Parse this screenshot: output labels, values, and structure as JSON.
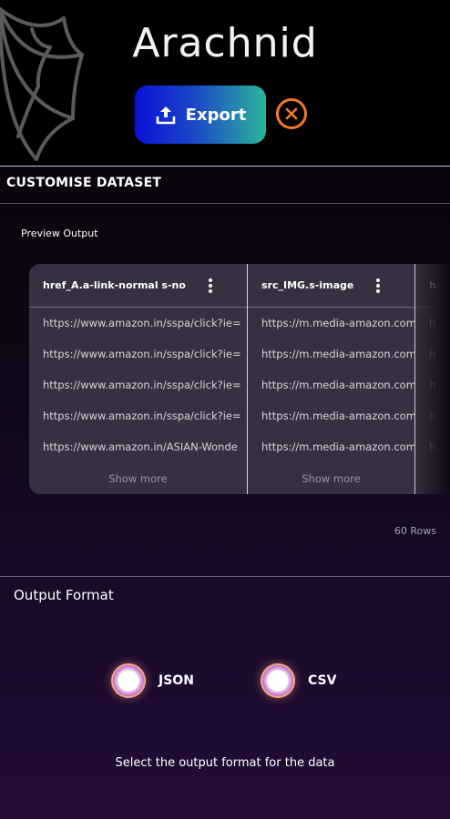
{
  "header": {
    "app_title": "Arachnid",
    "export_label": "Export"
  },
  "section": {
    "title": "CUSTOMISE DATASET",
    "preview_label": "Preview Output"
  },
  "table": {
    "columns": [
      {
        "header": "href_A.a-link-normal s-no",
        "cells": [
          "https://www.amazon.in/sspa/click?ie=",
          "https://www.amazon.in/sspa/click?ie=",
          "https://www.amazon.in/sspa/click?ie=",
          "https://www.amazon.in/sspa/click?ie=",
          "https://www.amazon.in/ASIAN-Wonde"
        ],
        "show_more": "Show more"
      },
      {
        "header": "src_IMG.s-image",
        "cells": [
          "https://m.media-amazon.com",
          "https://m.media-amazon.com",
          "https://m.media-amazon.com",
          "https://m.media-amazon.com",
          "https://m.media-amazon.com"
        ],
        "show_more": "Show more"
      },
      {
        "header": "h",
        "cells": [
          "h",
          "h",
          "h",
          "h",
          "h"
        ],
        "show_more": ""
      }
    ],
    "rows_count": "60 Rows"
  },
  "output": {
    "title": "Output Format",
    "options": [
      {
        "label": "JSON"
      },
      {
        "label": "CSV"
      }
    ],
    "hint": "Select the output format for the data"
  },
  "colors": {
    "export_gradient_start": "#0a12d8",
    "export_gradient_end": "#2bb59a",
    "close_accent": "#f07a2a",
    "table_bg": "#363040"
  }
}
